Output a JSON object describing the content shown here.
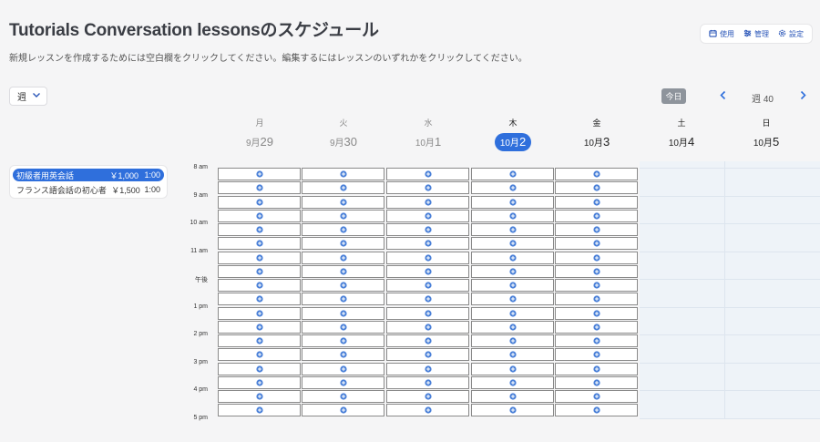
{
  "header": {
    "title": "Tutorials Conversation lessonsのスケジュール",
    "subtitle": "新規レッスンを作成するためには空白欄をクリックしてください。編集するにはレッスンのいずれかをクリックしてください。"
  },
  "toolbar": {
    "usage_label": "使用",
    "manage_label": "管理",
    "settings_label": "設定"
  },
  "view": {
    "selected": "週"
  },
  "nav": {
    "today_label": "今日",
    "week_label": "週 40"
  },
  "lessons": [
    {
      "name": "初級者用英会話",
      "price": "￥1,000",
      "duration": "1:00",
      "selected": true
    },
    {
      "name": "フランス語会話の初心者",
      "price": "￥1,500",
      "duration": "1:00",
      "selected": false
    }
  ],
  "days": [
    {
      "weekday": "月",
      "month": "9月",
      "day": "29",
      "state": "past"
    },
    {
      "weekday": "火",
      "month": "9月",
      "day": "30",
      "state": "past"
    },
    {
      "weekday": "水",
      "month": "10月",
      "day": "1",
      "state": "past"
    },
    {
      "weekday": "木",
      "month": "10月",
      "day": "2",
      "state": "today"
    },
    {
      "weekday": "金",
      "month": "10月",
      "day": "3",
      "state": "future"
    },
    {
      "weekday": "土",
      "month": "10月",
      "day": "4",
      "state": "future"
    },
    {
      "weekday": "日",
      "month": "10月",
      "day": "5",
      "state": "future"
    }
  ],
  "hours": [
    "8 am",
    "9 am",
    "10 am",
    "11 am",
    "午後",
    "1 pm",
    "2 pm",
    "3 pm",
    "4 pm",
    "5 pm"
  ],
  "colors": {
    "accent": "#2f6fdc",
    "today_button": "#8e949c",
    "weekend_background": "#eef3f8",
    "add_icon": "#4a80d8"
  }
}
